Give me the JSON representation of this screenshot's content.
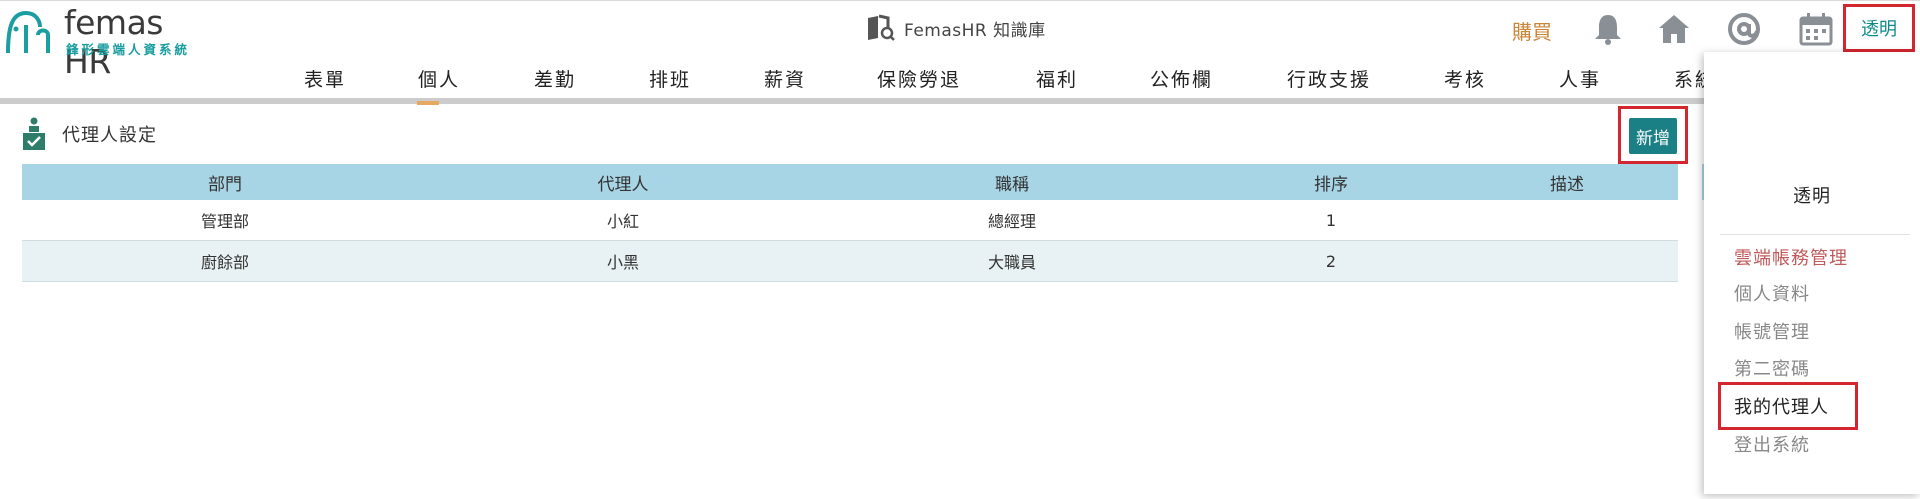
{
  "brand": {
    "name": "femas HR",
    "subtitle": "鋒形雲端人資系統"
  },
  "knowledge_base": {
    "label": "FemasHR 知識庫"
  },
  "top_actions": {
    "buy_label": "購買",
    "user_label": "透明",
    "icons": [
      "bell-icon",
      "home-icon",
      "at-icon",
      "calendar-icon"
    ]
  },
  "nav": {
    "items": [
      "表單",
      "個人",
      "差勤",
      "排班",
      "薪資",
      "保險勞退",
      "福利",
      "公佈欄",
      "行政支援",
      "考核",
      "人事",
      "系統"
    ]
  },
  "page": {
    "title": "代理人設定",
    "add_label": "新增"
  },
  "table": {
    "headers": [
      "部門",
      "代理人",
      "職稱",
      "排序",
      "描述"
    ],
    "rows": [
      [
        "管理部",
        "小紅",
        "總經理",
        "1",
        ""
      ],
      [
        "廚餘部",
        "小黑",
        "大職員",
        "2",
        ""
      ]
    ]
  },
  "dropdown": {
    "user_name": "透明",
    "items": [
      "雲端帳務管理",
      "個人資料",
      "帳號管理",
      "第二密碼",
      "我的代理人",
      "登出系統"
    ]
  },
  "colors": {
    "accent": "#1b7f86",
    "header_bg": "#a8d5e6",
    "buy": "#c9873a",
    "highlight": "#d4262f"
  }
}
